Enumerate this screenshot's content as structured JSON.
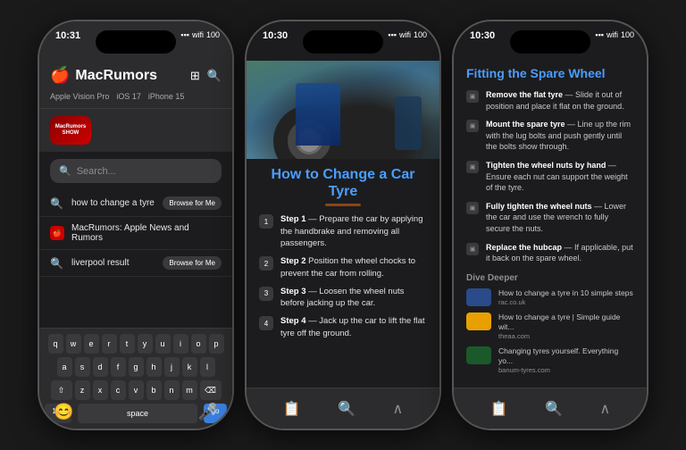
{
  "phones": {
    "phone1": {
      "status_time": "10:31",
      "title": "MacRumors",
      "nav_icons": [
        "⊞",
        "🔍"
      ],
      "tabs": [
        "Apple Vision Pro",
        "iOS 17",
        "iPhone 15"
      ],
      "show_label": "MacRumors\nSHOW",
      "search_placeholder": "Search...",
      "suggestions": [
        {
          "icon": "🔍",
          "text": "how to change a tyre",
          "action": "Browse for Me"
        },
        {
          "icon": "🔴",
          "text": "MacRumors: Apple News and Rumors",
          "action": null
        },
        {
          "icon": "🔍",
          "text": "liverpool result",
          "action": "Browse for Me"
        }
      ],
      "keyboard": {
        "rows": [
          [
            "q",
            "w",
            "e",
            "r",
            "t",
            "y",
            "u",
            "i",
            "o",
            "p"
          ],
          [
            "a",
            "s",
            "d",
            "f",
            "g",
            "h",
            "j",
            "k",
            "l"
          ],
          [
            "⇧",
            "z",
            "x",
            "c",
            "v",
            "b",
            "n",
            "m",
            "⌫"
          ],
          [
            "123",
            "space",
            "go"
          ]
        ]
      }
    },
    "phone2": {
      "status_time": "10:30",
      "title": "How to Change a Car Tyre",
      "steps": [
        {
          "num": "1",
          "bold": "Step 1",
          "text": " — Prepare the car by applying the handbrake and removing all passengers."
        },
        {
          "num": "2",
          "bold": "Step 2",
          "text": " Position the wheel chocks to prevent the car from rolling."
        },
        {
          "num": "3",
          "bold": "Step 3",
          "text": " — Loosen the wheel nuts before jacking up the car."
        },
        {
          "num": "4",
          "bold": "Step 4",
          "text": " — Jack up the car to lift the flat tyre off the ground."
        }
      ],
      "bottom_icons": [
        "📋",
        "🔍",
        "∧"
      ]
    },
    "phone3": {
      "status_time": "10:30",
      "title": "Fitting the Spare Wheel",
      "steps": [
        {
          "bold": "Remove the flat tyre",
          "text": " — Slide it out of position and place it flat on the ground."
        },
        {
          "bold": "Mount the spare tyre",
          "text": " — Line up the rim with the lug bolts and push gently until the bolts show through."
        },
        {
          "bold": "Tighten the wheel nuts by hand",
          "text": " — Ensure each nut can support the weight of the tyre."
        },
        {
          "bold": "Fully tighten the wheel nuts",
          "text": " — Lower the car and use the wrench to fully secure the nuts."
        },
        {
          "bold": "Replace the hubcap",
          "text": " — If applicable, put it back on the spare wheel."
        }
      ],
      "dive_deeper_title": "Dive Deeper",
      "links": [
        {
          "type": "rac",
          "title": "How to change a tyre in 10 simple steps",
          "domain": "rac.co.uk"
        },
        {
          "type": "theaa",
          "title": "How to change a tyre | Simple guide wit...",
          "domain": "theaa.com"
        },
        {
          "type": "banum",
          "title": "Changing tyres yourself. Everything yo...",
          "domain": "banum-tyres.com"
        }
      ],
      "bottom_icons": [
        "📋",
        "🔍",
        "∧"
      ]
    }
  }
}
